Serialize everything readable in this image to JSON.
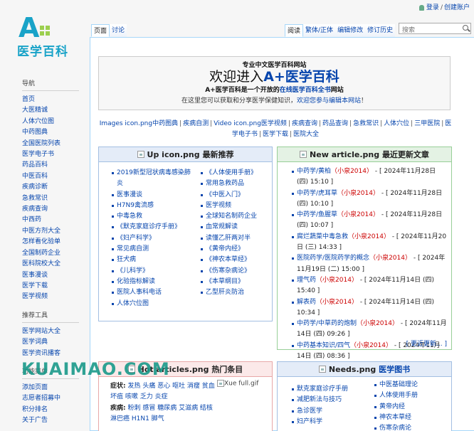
{
  "personal": {
    "login": "登录",
    "create": "创建账户"
  },
  "logo": {
    "letter": "A",
    "text": "医学百科"
  },
  "sidebar": {
    "nav_title": "导航",
    "nav": [
      "首页",
      "大医精诚",
      "人体穴位图",
      "中药图典",
      "全国医院列表",
      "医学电子书",
      "药品百科",
      "中医百科",
      "疾病诊断",
      "急救常识",
      "疾病查询",
      "中西药",
      "中医方剂大全",
      "怎样看化验单",
      "全国制药企业",
      "医科院校大全",
      "医事漫谈",
      "医学下载",
      "医学视频"
    ],
    "tools_title": "推荐工具",
    "tools": [
      "医学网站大全",
      "医学词典",
      "医学资讯播客"
    ],
    "func_title": "功能菜单",
    "func": [
      "添加页面",
      "志愿者招募中",
      "积分排名",
      "关于广告"
    ]
  },
  "tabs": {
    "page": "页面",
    "talk": "讨论",
    "read": "阅读",
    "variant": "繁体/正体",
    "edit": "编辑修改",
    "history": "修订历史"
  },
  "search": {
    "placeholder": "搜索"
  },
  "banner": {
    "sup": "专业中文医学百科网站",
    "welcome": "欢迎进入",
    "brand": "A+医学百科",
    "desc1": "A+医学百科是一个开放的",
    "desc2": "在线医学百科全书",
    "desc3": "网站",
    "know1": "在这里您可以获取和分享医学保健知识，",
    "know2": "欢迎您参与编辑本网站",
    "know3": "！"
  },
  "quicklinks": [
    "Images icon.png中药图典",
    "疾病自测",
    "Video icon.png医学视频",
    "疾病查询",
    "药品查询",
    "急救常识",
    "人体穴位",
    "三甲医院",
    "医学电子书",
    "医学下载",
    "医院大全"
  ],
  "box_up": {
    "img": "Up icon.png",
    "title": "最新推荐",
    "col1": [
      "2019新型冠状病毒感染肺炎",
      "医事漫谈",
      "H7N9禽流感",
      "中毒急救",
      "《默克家庭诊疗手册》",
      "《妇产科学》",
      "常见病自测",
      "狂犬病",
      "《儿科学》",
      "化验指标解读",
      "医院人事科电话",
      "人体穴位图"
    ],
    "col2": [
      "《人体使用手册》",
      "常用急救药品",
      "《中医入门》",
      "医学视频",
      "全球知名制药企业",
      "血常规解读",
      "读懂乙肝两对半",
      "《黄帝内经》",
      "《神农本草经》",
      "《伤寒杂病论》",
      "《本草纲目》",
      "乙型肝炎防治"
    ]
  },
  "box_new": {
    "img": "New article.png",
    "title": "最近更新文章",
    "more": "[ 更近更新... ]",
    "items": [
      {
        "t": "中药学/黄柏",
        "u": "小泉2014",
        "d": " - [ 2024年11月28日 (四) 15:10 ]"
      },
      {
        "t": "中药学/虎耳草",
        "u": "小泉2014",
        "d": " - [ 2024年11月28日 (四) 10:10 ]"
      },
      {
        "t": "中药学/鱼腥草",
        "u": "小泉2014",
        "d": " - [ 2024年11月28日 (四) 10:07 ]"
      },
      {
        "t": "腐烂蔬菜中毒急救",
        "u": "小泉2014",
        "d": " - [ 2024年11月20日 (三) 14:33 ]"
      },
      {
        "t": "医院药学/医院药学的概念",
        "u": "小泉2014",
        "d": " - [ 2024年11月19日 (二) 15:00 ]"
      },
      {
        "t": "理气药",
        "u": "小泉2014",
        "d": " - [ 2024年11月14日 (四) 15:40 ]"
      },
      {
        "t": "解表药",
        "u": "小泉2014",
        "d": " - [ 2024年11月14日 (四) 10:34 ]"
      },
      {
        "t": "中药学/中草药的炮制",
        "u": "小泉2014",
        "d": " - [ 2024年11月14日 (四) 09:26 ]"
      },
      {
        "t": "中药基本知识/四气",
        "u": "小泉2014",
        "d": " - [ 2024年11月14日 (四) 08:36 ]"
      },
      {
        "t": "天麻",
        "u": "小泉2014",
        "d": " - [ 2024年11月13日 (三) 11:03 ]"
      }
    ]
  },
  "box_hot": {
    "img": "Hot articles.png",
    "title": "热门条目",
    "img2": "Xue full.gif",
    "l1label": "症状:",
    "l1": "发热 头痛 恶心 呕吐 消瘦 贫血 坏疽 咳嗽 乏力 炎症",
    "l2label": "疾病:",
    "l2": "粉刺 感冒 糖尿病 艾滋病 结核 淋巴癌 H1N1 脚气"
  },
  "box_needs": {
    "img": "Needs.png",
    "title": "医学图书",
    "col1": [
      "默克家庭诊疗手册",
      "减肥新法与技巧",
      "急诊医学",
      "妇产科学"
    ],
    "col2": [
      "中医基础理论",
      "人体使用手册",
      "黄帝内经",
      "神农本草经",
      "伤寒杂病论"
    ]
  },
  "watermark": "KUAIMAO.COM",
  "colors": {
    "accent": "#19a3c8",
    "link": "#0645ad",
    "box_blue": "#a3bfe2",
    "box_green": "#98cf98",
    "box_pink": "#e8a8a8"
  }
}
